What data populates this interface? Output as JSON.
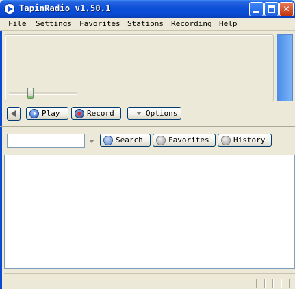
{
  "window": {
    "title": "TapinRadio v1.50.1",
    "controls": {
      "minimize": "",
      "maximize": "",
      "close": "✕"
    }
  },
  "menu": [
    {
      "first": "F",
      "rest": "ile"
    },
    {
      "first": "S",
      "rest": "ettings"
    },
    {
      "first": "F",
      "rest": "avorites"
    },
    {
      "first": "S",
      "rest": "tations"
    },
    {
      "first": "R",
      "rest": "ecording"
    },
    {
      "first": "H",
      "rest": "elp"
    }
  ],
  "player": {
    "volume": 0.3,
    "play_label": "Play",
    "record_label": "Record",
    "options_label": "Options"
  },
  "search": {
    "input_value": "",
    "search_label": "Search",
    "favorites_label": "Favorites",
    "history_label": "History"
  },
  "colors": {
    "accent": "#0a4ad2",
    "meter": "#4a8ce8"
  }
}
